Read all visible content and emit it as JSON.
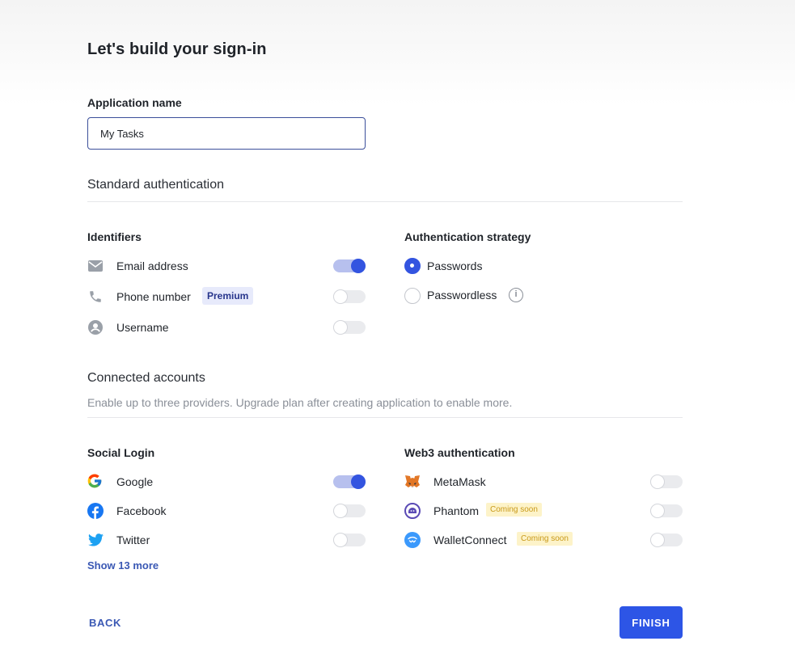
{
  "page": {
    "title": "Let's build your sign-in"
  },
  "app_name": {
    "label": "Application name",
    "value": "My Tasks"
  },
  "standard_auth": {
    "title": "Standard authentication",
    "identifiers": {
      "title": "Identifiers",
      "items": [
        {
          "label": "Email address",
          "icon": "envelope-icon",
          "enabled": true
        },
        {
          "label": "Phone number",
          "icon": "phone-icon",
          "badge": "Premium",
          "enabled": false
        },
        {
          "label": "Username",
          "icon": "user-circle-icon",
          "enabled": false
        }
      ]
    },
    "strategy": {
      "title": "Authentication strategy",
      "options": [
        {
          "label": "Passwords",
          "selected": true
        },
        {
          "label": "Passwordless",
          "selected": false,
          "info_icon": "info-icon",
          "info_glyph": "i"
        }
      ]
    }
  },
  "connected_accounts": {
    "title": "Connected accounts",
    "description": "Enable up to three providers. Upgrade plan after creating application to enable more.",
    "social": {
      "title": "Social Login",
      "items": [
        {
          "label": "Google",
          "icon": "google-icon",
          "enabled": true
        },
        {
          "label": "Facebook",
          "icon": "facebook-icon",
          "enabled": false
        },
        {
          "label": "Twitter",
          "icon": "twitter-icon",
          "enabled": false
        }
      ],
      "more_link": "Show 13 more"
    },
    "web3": {
      "title": "Web3 authentication",
      "items": [
        {
          "label": "MetaMask",
          "icon": "metamask-icon",
          "enabled": false
        },
        {
          "label": "Phantom",
          "icon": "phantom-icon",
          "badge": "Coming soon",
          "enabled": false
        },
        {
          "label": "WalletConnect",
          "icon": "walletconnect-icon",
          "badge": "Coming soon",
          "enabled": false
        }
      ]
    }
  },
  "footer": {
    "back_label": "BACK",
    "finish_label": "FINISH"
  },
  "colors": {
    "accent": "#2d55e6",
    "toggle_on_track": "#b7c0ee",
    "premium_bg": "#e7eafb",
    "soon_bg": "#fdf3c9"
  }
}
